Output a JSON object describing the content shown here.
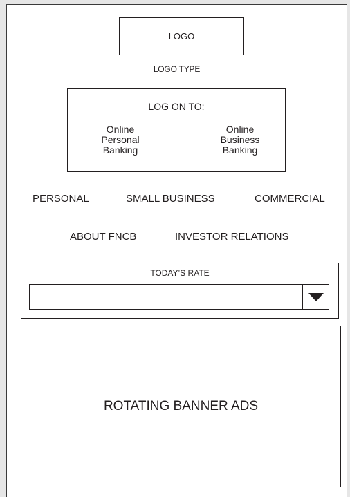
{
  "header": {
    "logo": "LOGO",
    "logo_type": "LOGO TYPE"
  },
  "logon": {
    "title": "LOG ON TO:",
    "personal": "Online\nPersonal\nBanking",
    "business": "Online\nBusiness\nBanking"
  },
  "nav": {
    "row1": [
      "PERSONAL",
      "SMALL BUSINESS",
      "COMMERCIAL"
    ],
    "row2": [
      "ABOUT FNCB",
      "INVESTOR RELATIONS"
    ]
  },
  "rates": {
    "title": "TODAY’S RATE",
    "selected": "",
    "icon": "triangle-down-icon"
  },
  "banner": {
    "text": "ROTATING BANNER ADS"
  }
}
